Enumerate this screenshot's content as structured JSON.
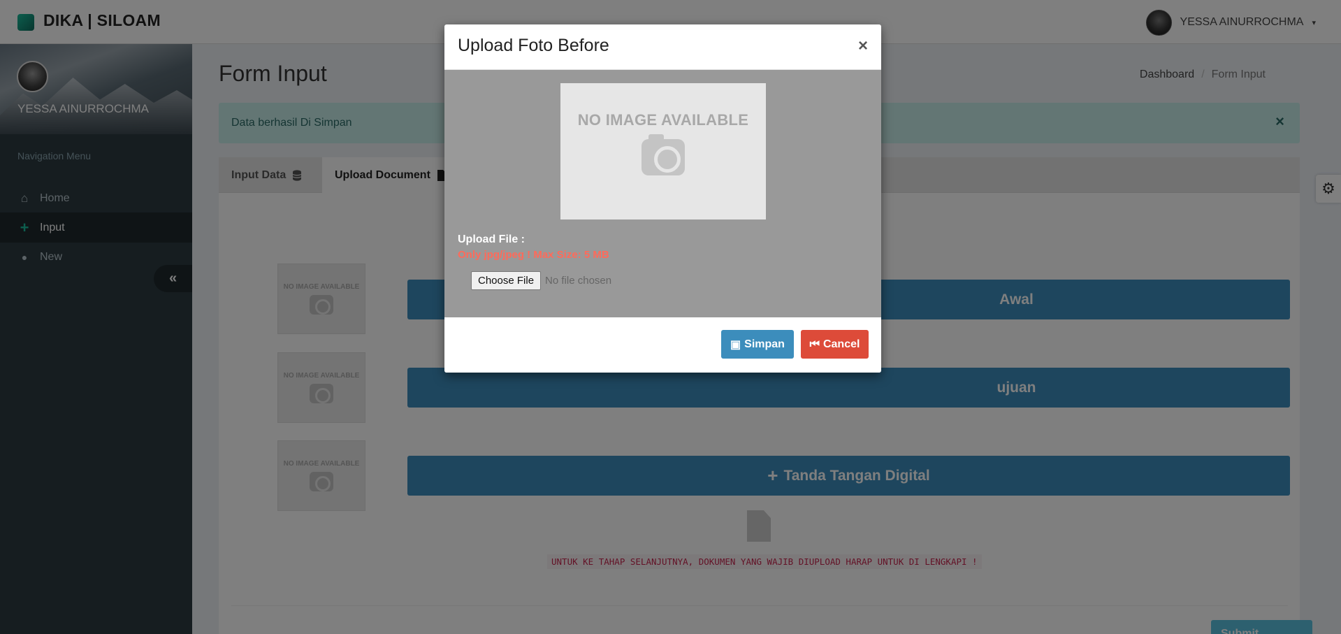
{
  "app": {
    "brand": "DIKA | SILOAM",
    "accent_color": "#3c8dbc"
  },
  "header": {
    "user_name": "YESSA AINURROCHMA",
    "caret": "▾"
  },
  "sidebar": {
    "user_name": "YESSA AINURROCHMA",
    "nav_header": "Navigation Menu",
    "items": [
      {
        "label": "Home",
        "icon": "home-icon",
        "glyph": "⌂"
      },
      {
        "label": "Input",
        "icon": "plus-icon",
        "glyph": "+"
      },
      {
        "label": "New",
        "icon": "user-icon",
        "glyph": "●"
      }
    ],
    "collapse_glyph": "«"
  },
  "page": {
    "title": "Form Input",
    "breadcrumb": [
      "Dashboard",
      "/",
      "Form Input"
    ]
  },
  "alert": {
    "text": "Data berhasil Di Simpan",
    "close": "×"
  },
  "tabs": [
    {
      "label": "Input Data",
      "icon": "database-icon"
    },
    {
      "label": "Upload Document",
      "icon": "file-icon"
    }
  ],
  "thumbs": {
    "text": "NO IMAGE AVAILABLE"
  },
  "upload_buttons": [
    {
      "label": "Awal"
    },
    {
      "label": "ujuan"
    },
    {
      "label": "Tanda Tangan Digital",
      "glyph": "+"
    }
  ],
  "warning": "UNTUK KE TAHAP SELANJUTNYA, DOKUMEN YANG WAJIB DIUPLOAD HARAP UNTUK DI LENGKAPI !",
  "submit": {
    "label": "Submit"
  },
  "settings_glyph": "⚙",
  "modal": {
    "title": "Upload Foto Before",
    "close": "×",
    "preview_text": "NO IMAGE AVAILABLE",
    "upload_label": "Upload File :",
    "upload_hint": "Only jpg/jpeg ! Max Size: 5 MB",
    "choose_file": "Choose File",
    "no_file": "No file chosen",
    "save_label": "Simpan",
    "cancel_label": "Cancel",
    "save_glyph": "▣",
    "cancel_glyph": "⏮"
  }
}
